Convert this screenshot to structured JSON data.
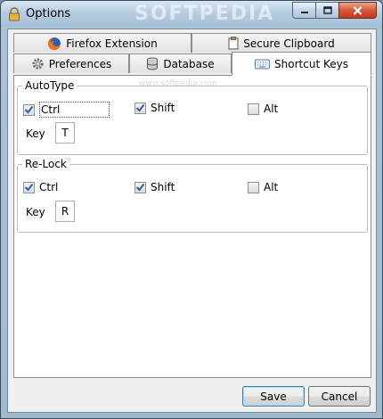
{
  "window": {
    "title": "Options",
    "watermark_title": "SOFTPEDIA",
    "watermark_inline": "www.softpedia.com"
  },
  "tabs": {
    "row1": [
      {
        "label": "Firefox Extension",
        "icon": "firefox-icon"
      },
      {
        "label": "Secure Clipboard",
        "icon": "clipboard-icon"
      }
    ],
    "row2": [
      {
        "label": "Preferences",
        "icon": "gear-icon"
      },
      {
        "label": "Database",
        "icon": "database-icon"
      },
      {
        "label": "Shortcut Keys",
        "icon": "keyboard-icon",
        "active": true
      }
    ]
  },
  "autotype": {
    "title": "AutoType",
    "ctrl": {
      "label": "Ctrl",
      "checked": true
    },
    "shift": {
      "label": "Shift",
      "checked": true
    },
    "alt": {
      "label": "Alt",
      "checked": false
    },
    "key_label": "Key",
    "key_value": "T"
  },
  "relock": {
    "title": "Re-Lock",
    "ctrl": {
      "label": "Ctrl",
      "checked": true
    },
    "shift": {
      "label": "Shift",
      "checked": true
    },
    "alt": {
      "label": "Alt",
      "checked": false
    },
    "key_label": "Key",
    "key_value": "R"
  },
  "footer": {
    "save_label": "Save",
    "cancel_label": "Cancel"
  },
  "colors": {
    "check": "#2b5fa8",
    "accent": "#3c7fb1"
  }
}
